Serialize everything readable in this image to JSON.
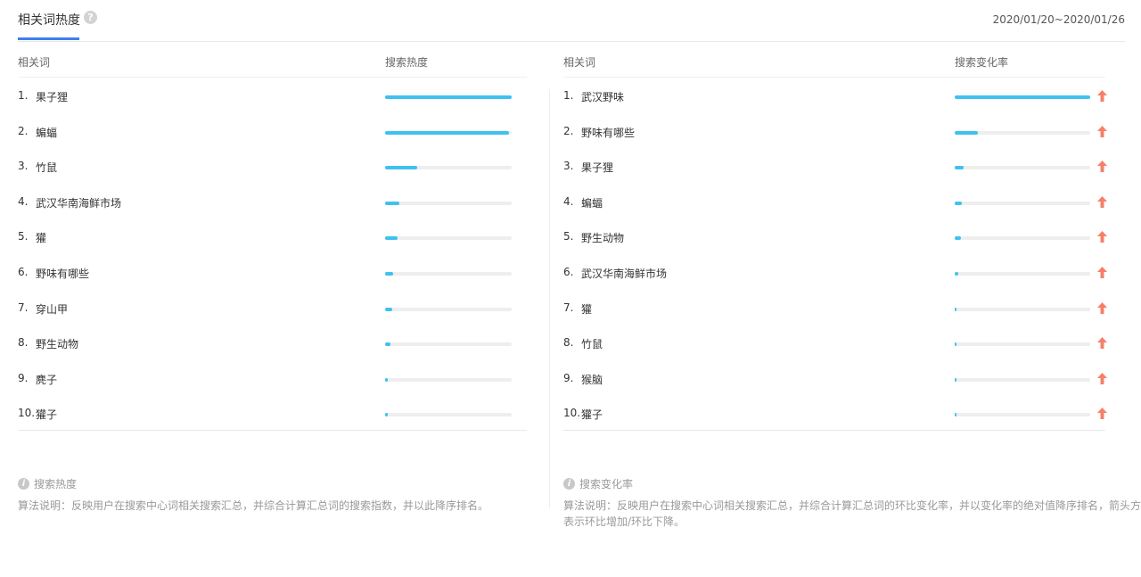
{
  "header": {
    "title": "相关词热度",
    "help_icon": "question-circle-icon",
    "date_range": "2020/01/20~2020/01/26"
  },
  "left_table": {
    "col_term": "相关词",
    "col_metric": "搜索热度",
    "bar_color": "#3fc1f0",
    "rows": [
      {
        "rank": "1.",
        "term": "果子狸",
        "level": 1.0
      },
      {
        "rank": "2.",
        "term": "蝙蝠",
        "level": 0.98
      },
      {
        "rank": "3.",
        "term": "竹鼠",
        "level": 0.25
      },
      {
        "rank": "4.",
        "term": "武汉华南海鲜市场",
        "level": 0.11
      },
      {
        "rank": "5.",
        "term": "獾",
        "level": 0.1
      },
      {
        "rank": "6.",
        "term": "野味有哪些",
        "level": 0.06
      },
      {
        "rank": "7.",
        "term": "穿山甲",
        "level": 0.055
      },
      {
        "rank": "8.",
        "term": "野生动物",
        "level": 0.04
      },
      {
        "rank": "9.",
        "term": "麂子",
        "level": 0.02
      },
      {
        "rank": "10.",
        "term": "獾子",
        "level": 0.02
      }
    ]
  },
  "right_table": {
    "col_term": "相关词",
    "col_metric": "搜索变化率",
    "bar_color": "#3fc1f0",
    "arrow_color": "#f5806a",
    "arrow_icon": "arrow-up-icon",
    "rows": [
      {
        "rank": "1.",
        "term": "武汉野味",
        "level": 1.0
      },
      {
        "rank": "2.",
        "term": "野味有哪些",
        "level": 0.17
      },
      {
        "rank": "3.",
        "term": "果子狸",
        "level": 0.065
      },
      {
        "rank": "4.",
        "term": "蝙蝠",
        "level": 0.055
      },
      {
        "rank": "5.",
        "term": "野生动物",
        "level": 0.045
      },
      {
        "rank": "6.",
        "term": "武汉华南海鲜市场",
        "level": 0.025
      },
      {
        "rank": "7.",
        "term": "獾",
        "level": 0.015
      },
      {
        "rank": "8.",
        "term": "竹鼠",
        "level": 0.012
      },
      {
        "rank": "9.",
        "term": "猴脑",
        "level": 0.01
      },
      {
        "rank": "10.",
        "term": "獾子",
        "level": 0.008
      }
    ]
  },
  "notes": {
    "left": {
      "title": "搜索热度",
      "desc": "算法说明：反映用户在搜索中心词相关搜索汇总，并综合计算汇总词的搜索指数，并以此降序排名。"
    },
    "right": {
      "title": "搜索变化率",
      "desc": "算法说明：反映用户在搜索中心词相关搜索汇总，并综合计算汇总词的环比变化率，并以变化率的绝对值降序排名，箭头方向表示环比增加/环比下降。"
    }
  }
}
